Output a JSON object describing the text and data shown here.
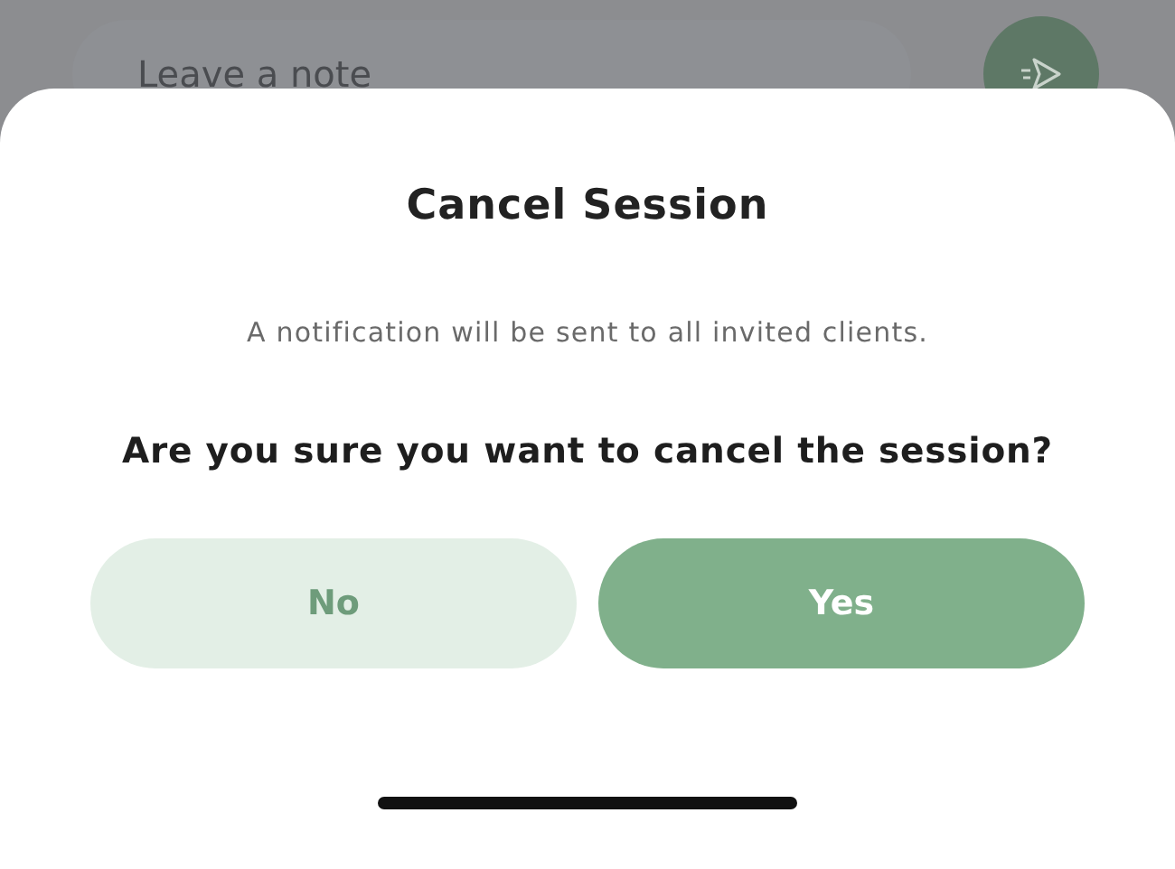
{
  "note_field": {
    "placeholder": "Leave a note"
  },
  "dialog": {
    "title": "Cancel Session",
    "message": "A notification will be sent to all invited clients.",
    "question": "Are you sure you want to cancel the session?",
    "buttons": [
      {
        "label": "No",
        "kind": "secondary"
      },
      {
        "label": "Yes",
        "kind": "primary"
      }
    ]
  }
}
